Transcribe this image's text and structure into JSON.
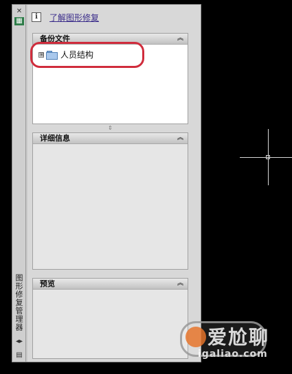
{
  "palette": {
    "title": "图形修复管理器",
    "top_link_icon": "info-icon",
    "top_link": "了解图形修复",
    "titlebar_icons": [
      "pin-icon",
      "palette-icon",
      "properties-icon",
      "menu-icon"
    ]
  },
  "panels": {
    "backup": {
      "title": "备份文件",
      "items": [
        {
          "label": "人员结构",
          "expander": "⊞",
          "icon": "folder-icon"
        }
      ]
    },
    "details": {
      "title": "详细信息"
    },
    "preview": {
      "title": "预览"
    }
  },
  "annotation": {
    "color": "#d02c3c"
  },
  "watermark": {
    "text_main": "爱尬聊",
    "text_sub": "igaliao.com"
  }
}
